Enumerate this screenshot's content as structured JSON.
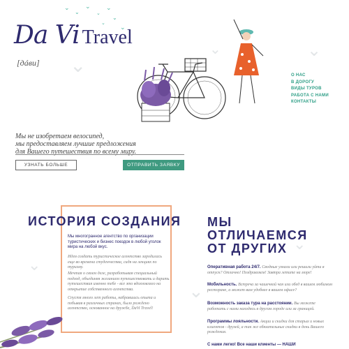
{
  "logo": {
    "script": "Da Vi",
    "word": "Travel",
    "transcription": "[дáви]"
  },
  "nav": {
    "items": [
      "О НАС",
      "В ДОРОГУ",
      "ВИДЫ ТУРОВ",
      "РАБОТА С НАМИ",
      "КОНТАКТЫ"
    ]
  },
  "hero": {
    "tagline": [
      "Мы не изобретаем велосипед,",
      "мы предоставляем лучшие предложения",
      "для Вашего путешествия по всему миру."
    ],
    "learn_more": "УЗНАТЬ БОЛЬШЕ",
    "send_request": "ОТПРАВИТЬ ЗАЯВКУ"
  },
  "history": {
    "title": "ИСТОРИЯ СОЗДАНИЯ",
    "lead": "Мы многогранное агентство по организации туристических и бизнес поездок в любой уголок мира на любой вкус.",
    "paragraphs": [
      "Идея создать туристическое агентство зародилась еще во времена студенчества, сидя на лекциях по туризму.",
      "Мечтая о своем деле, разработывая специальный подход, объединяя желанием путешествовать и дарить путешествия именно тебе - все это вдохновляло на открытие собственного агентства.",
      "Спустя много лет работы, набравшись опыта и побывав в различных странах, было рождено агентство, основанное на дружбе, DaVi Travel!"
    ]
  },
  "differences": {
    "title": [
      "МЫ",
      "ОТЛИЧАЕМСЯ",
      "ОТ ДРУГИХ"
    ],
    "items": [
      {
        "key": "Оперативная работа 24/7.",
        "text": "Сводные узнали или решили уйти в отпуск? Отлично! Поздравляем! Завтра летите на море!"
      },
      {
        "key": "Мобильность.",
        "text": "Встреча за чашечкой чая или обед в вашем любимом ресторане, а может вам удобнее в вашем офисе?"
      },
      {
        "key": "Возможность заказа тура на расстоянии.",
        "text": "Вы можете работать с нами находясь в другом городе или за границей."
      },
      {
        "key": "Программы лояльности.",
        "text": "Акции и скидки для старых и новых клиентов - друзей, а так же обязательные скидки в день Вашего рождения."
      },
      {
        "key": "С нами легко! Все наши клиенты — НАШИ",
        "text": ""
      }
    ]
  },
  "colors": {
    "brand": "#2e2a6e",
    "accent": "#3f9a80",
    "frame": "#f0a87e"
  }
}
